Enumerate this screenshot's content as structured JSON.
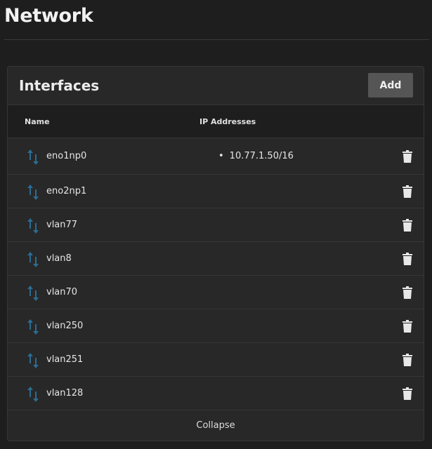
{
  "page": {
    "title": "Network"
  },
  "card": {
    "title": "Interfaces",
    "add_label": "Add",
    "collapse_label": "Collapse"
  },
  "table": {
    "columns": [
      "Name",
      "IP Addresses"
    ],
    "rows": [
      {
        "name": "eno1np0",
        "ips": [
          "10.77.1.50/16"
        ]
      },
      {
        "name": "eno2np1",
        "ips": []
      },
      {
        "name": "vlan77",
        "ips": []
      },
      {
        "name": "vlan8",
        "ips": []
      },
      {
        "name": "vlan70",
        "ips": []
      },
      {
        "name": "vlan250",
        "ips": []
      },
      {
        "name": "vlan251",
        "ips": []
      },
      {
        "name": "vlan128",
        "ips": []
      }
    ]
  },
  "icons": {
    "row_icon": "up-down-arrows-icon",
    "delete_icon": "trash-icon"
  },
  "colors": {
    "background": "#1e1e1e",
    "card": "#282828",
    "add_button": "#555555",
    "arrow_icon": "#2a6d93"
  }
}
